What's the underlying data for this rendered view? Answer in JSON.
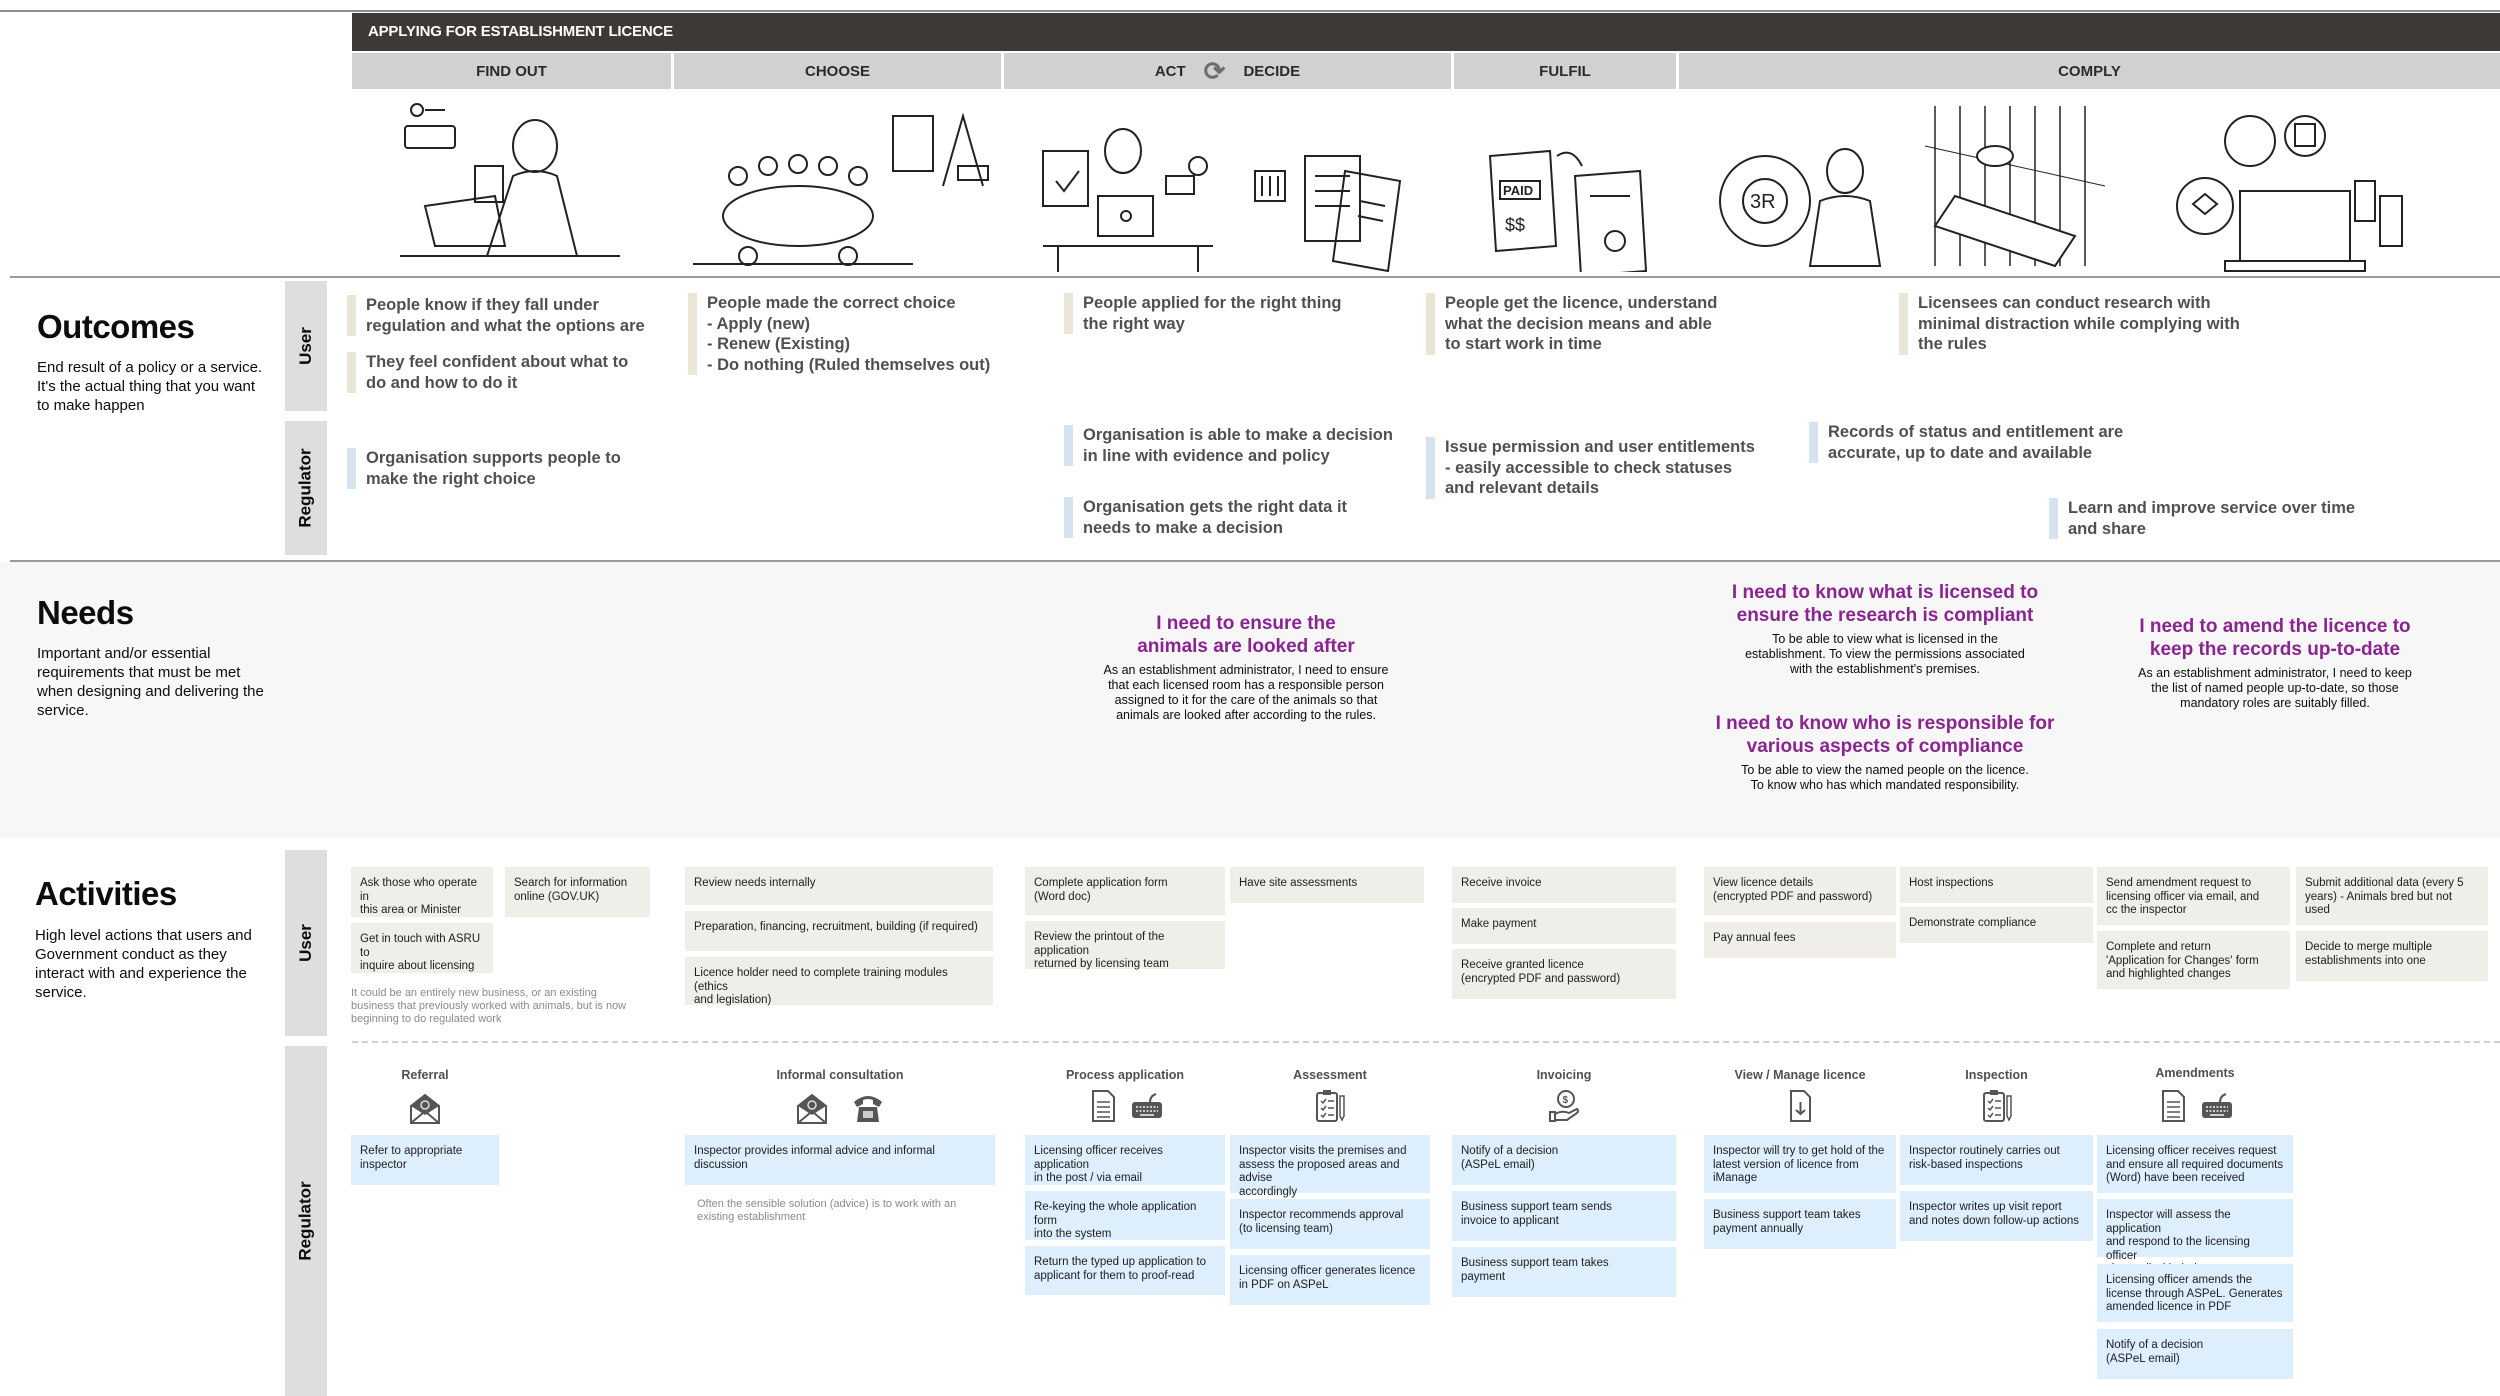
{
  "journey": {
    "title": "APPLYING FOR ESTABLISHMENT LICENCE",
    "stages": [
      {
        "label": "FIND OUT"
      },
      {
        "label": "CHOOSE"
      },
      {
        "label": "ACT",
        "label2": "DECIDE",
        "icon": "cycle-arrows-icon"
      },
      {
        "label": "FULFIL"
      },
      {
        "label": "COMPLY"
      }
    ],
    "illustrations": [
      "person-at-laptop-searching-gov-uk",
      "team-meeting-around-table-with-building",
      "person-filling-application-at-desk",
      "documents-and-checklist",
      "paid-invoice-and-certificate",
      "3r-cycle-scientist",
      "hand-holding-animal-record",
      "computer-with-compliance-documents"
    ]
  },
  "outcomes": {
    "title": "Outcomes",
    "description": "End result of a policy or a service. It's the actual thing that you want to make happen",
    "lanes": {
      "user": "User",
      "regulator": "Regulator"
    },
    "user": [
      "People know if they fall under\nregulation and what the options are",
      "They feel confident about what to\ndo and how to do it",
      "People made the correct choice\n- Apply (new)\n- Renew (Existing)\n- Do nothing (Ruled themselves out)",
      "People applied for the right thing\nthe right way",
      "People get the licence, understand\nwhat the decision means and able\nto start work in time",
      "Licensees can conduct research with\nminimal distraction while complying with\nthe rules"
    ],
    "regulator": [
      "Organisation supports people to\nmake the right choice",
      "Organisation is able to make a decision\nin line with evidence and policy",
      "Organisation gets the right data it\nneeds to make a decision",
      "Issue permission and user entitlements\n- easily accessible to check statuses\nand relevant details",
      "Records of status and entitlement are\naccurate, up to date and available",
      "Learn and improve service over time\nand share"
    ]
  },
  "needs": {
    "title": "Needs",
    "description": "Important and/or essential requirements that must be met when designing and delivering the service.",
    "items": [
      {
        "title": "I need to ensure the\nanimals are looked after",
        "body": "As an establishment administrator, I need to ensure\nthat each licensed room has a responsible person\nassigned to it for the care of the animals so that\nanimals are looked after according to the rules."
      },
      {
        "title": "I need to know what is licensed to\nensure the research is compliant",
        "body": "To be able to view what is licensed in the\nestablishment. To view the permissions associated\nwith the establishment's premises."
      },
      {
        "title": "I need to know who is responsible for\nvarious aspects of compliance",
        "body": "To be able to view the named people on the licence.\nTo know who has which mandated responsibility."
      },
      {
        "title": "I need to amend the licence to\nkeep the records up-to-date",
        "body": "As an establishment administrator, I need to keep\nthe list of named people up-to-date, so those\nmandatory roles are suitably filled."
      }
    ]
  },
  "activities": {
    "title": "Activities",
    "description": "High level actions that users and Government conduct as they interact with and experience the service.",
    "lanes": {
      "user": "User",
      "regulator": "Regulator"
    },
    "user": {
      "find_out": [
        "Ask those who operate in\nthis area or Minister",
        "Search for information\nonline (GOV.UK)",
        "Get in touch with ASRU to\ninquire about licensing"
      ],
      "find_out_note": "It could be an entirely  new business, or an existing\nbusiness that previously worked with animals, but is now\nbeginning to do regulated work",
      "choose": [
        "Review needs internally",
        "Preparation, financing, recruitment, building (if required)",
        "Licence holder need to complete training modules (ethics\nand legislation)"
      ],
      "act": [
        "Complete application form\n(Word doc)",
        "Review the printout of the application\nreturned by licensing team"
      ],
      "decide": [
        "Have site assessments"
      ],
      "fulfil": [
        "Receive invoice",
        "Make payment",
        "Receive granted licence\n(encrypted PDF and password)"
      ],
      "view": [
        "View licence details\n(encrypted PDF and password)",
        "Pay annual fees"
      ],
      "inspect": [
        "Host inspections",
        "Demonstrate compliance"
      ],
      "amend": [
        "Send amendment request to\nlicensing officer via email, and\ncc the inspector",
        "Complete and return\n'Application for Changes' form\nand highlighted changes"
      ],
      "other": [
        "Submit additional data (every 5\nyears) - Animals bred but not\nused",
        "Decide to merge multiple\nestablishments into one"
      ]
    },
    "regulator": {
      "groups": [
        {
          "title": "Referral",
          "icons": [
            "email-icon"
          ],
          "cards": [
            "Refer to appropriate\ninspector"
          ]
        },
        {
          "title": "Informal consultation",
          "icons": [
            "email-icon",
            "telephone-icon"
          ],
          "cards": [
            "Inspector provides informal advice and informal discussion"
          ],
          "note": "Often the sensible solution (advice) is to work with an\nexisting establishment"
        },
        {
          "title": "Process application",
          "icons": [
            "document-icon",
            "keyboard-icon"
          ],
          "cards": [
            "Licensing officer receives application\nin the post / via email",
            "Re-keying the whole application form\ninto the system",
            "Return the typed up application to\napplicant for them to proof-read"
          ]
        },
        {
          "title": "Assessment",
          "icons": [
            "checklist-icon"
          ],
          "cards": [
            "Inspector visits the premises and\nassess the proposed areas and advise\naccordingly",
            "Inspector recommends approval\n(to licensing team)",
            "Licensing officer generates licence\nin PDF on ASPeL"
          ]
        },
        {
          "title": "Invoicing",
          "icons": [
            "payment-icon"
          ],
          "cards": [
            "Notify of a decision\n(ASPeL email)",
            "Business support team sends\ninvoice to applicant",
            "Business support team takes\npayment"
          ]
        },
        {
          "title": "View / Manage licence",
          "icons": [
            "download-file-icon"
          ],
          "cards": [
            "Inspector will try to get hold of the\nlatest version of licence from\niManage",
            "Business support team takes\npayment annually"
          ]
        },
        {
          "title": "Inspection",
          "icons": [
            "checklist-icon"
          ],
          "cards": [
            "Inspector routinely carries out\nrisk-based inspections",
            "Inspector writes up visit report\nand notes down follow-up actions"
          ]
        },
        {
          "title": "Amendments",
          "icons": [
            "document-icon",
            "keyboard-icon"
          ],
          "cards": [
            "Licensing officer receives request\nand ensure all required documents\n(Word) have been received",
            "Inspector will assess the application\nand respond to the licensing officer\nvia email with their recommendation",
            "Licensing officer amends the\nlicense through ASPeL. Generates\namended licence in PDF",
            "Notify of a decision\n(ASPeL email)"
          ]
        }
      ]
    }
  },
  "colors": {
    "header_dark": "#3d3a35",
    "stage_bar": "#d1d1d1",
    "need_title": "#8a2491",
    "user_card": "#efeee8",
    "regulator_card": "#ddeefd",
    "user_outcome_accent": "#e9e6d6",
    "regulator_outcome_accent": "#d6e3ef"
  }
}
